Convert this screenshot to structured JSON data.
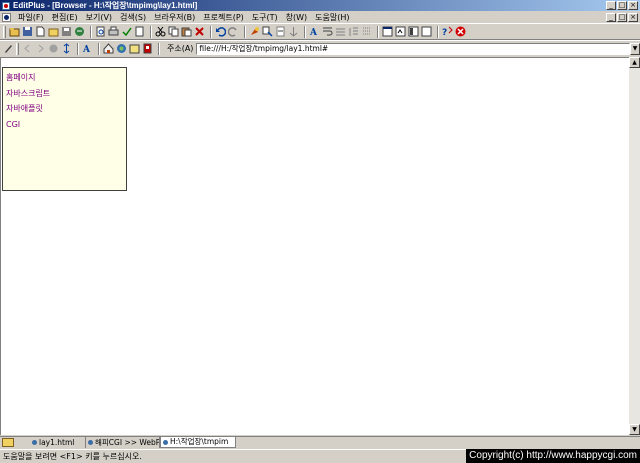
{
  "window": {
    "title": "EditPlus - [Browser - H:\\작업장\\tmpimg\\lay1.html]",
    "min_symbol": "_",
    "max_symbol": "□",
    "close_symbol": "×"
  },
  "menu": {
    "items": [
      "파일(F)",
      "편집(E)",
      "보기(V)",
      "검색(S)",
      "브라우저(B)",
      "프로젝트(P)",
      "도구(T)",
      "창(W)",
      "도움말(H)"
    ]
  },
  "toolbar1": {
    "icons": [
      "open-icon",
      "save-icon",
      "new-icon",
      "open-folder-icon",
      "save-all-icon",
      "ftp-icon",
      "print-preview-icon",
      "print-icon",
      "spell-icon",
      "cut-icon",
      "copy-icon",
      "paste-icon",
      "delete-icon",
      "undo-icon",
      "redo-icon",
      "find-icon",
      "replace-icon",
      "goto-icon",
      "wordwrap-icon",
      "font-icon",
      "ruler-icon",
      "line-number-icon",
      "column-icon",
      "window-icon",
      "output-icon",
      "cliptext-icon",
      "directory-icon",
      "help-icon",
      "close-icon"
    ]
  },
  "toolbar2": {
    "address_label": "주소(A)",
    "address_value": "file:///H:/작업장/tmpimg/lay1.html#"
  },
  "page": {
    "links": [
      "홈페이지",
      "자바스크립트",
      "자바애플릿",
      "CGI"
    ]
  },
  "tabs": [
    {
      "label": "lay1.html",
      "active": false
    },
    {
      "label": "해피CGI >> WebPr",
      "active": false
    },
    {
      "label": "H:\\작업장\\tmpim",
      "active": true
    }
  ],
  "status": {
    "text": "도움말을 보려면 <F1> 키를 누르십시오.",
    "watermark": "Copyright(c) http://www.happycgi.com"
  },
  "colors": {
    "title_start": "#0a246a",
    "title_end": "#a6caf0",
    "link": "#800080",
    "box_bg": "#ffffe8"
  }
}
